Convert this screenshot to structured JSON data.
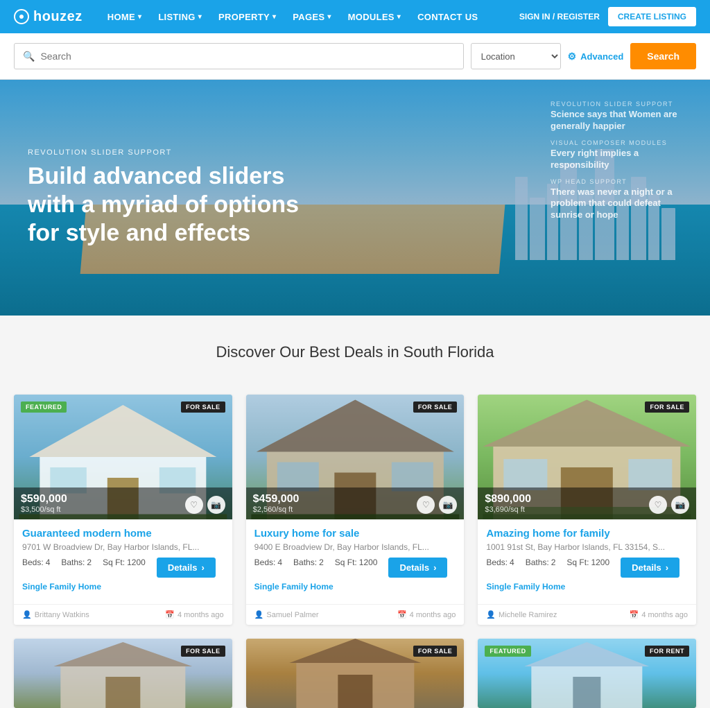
{
  "brand": {
    "name": "houzez"
  },
  "navbar": {
    "links": [
      {
        "label": "HOME",
        "has_dropdown": true
      },
      {
        "label": "LISTING",
        "has_dropdown": true
      },
      {
        "label": "PROPERTY",
        "has_dropdown": true
      },
      {
        "label": "PAGES",
        "has_dropdown": true
      },
      {
        "label": "MODULES",
        "has_dropdown": true
      },
      {
        "label": "CONTACT US",
        "has_dropdown": false
      }
    ],
    "signin_label": "SIGN IN / REGISTER",
    "create_label": "CREATE LISTING"
  },
  "search_bar": {
    "placeholder": "Search",
    "location_label": "Location",
    "advanced_label": "Advanced",
    "search_button": "Search"
  },
  "hero": {
    "subtitle": "REVOLUTION SLIDER SUPPORT",
    "title": "Build advanced sliders with a myriad of options for style and effects",
    "side_cards": [
      {
        "subtitle": "REVOLUTION SLIDER SUPPORT",
        "title": "Science says that Women are generally happier"
      },
      {
        "subtitle": "VISUAL COMPOSER MODULES",
        "title": "Every right implies a responsibility"
      },
      {
        "subtitle": "WP HEAD SUPPORT",
        "title": "There was never a night or a problem that could defeat sunrise or hope"
      }
    ]
  },
  "section": {
    "title": "Discover Our Best Deals in South Florida"
  },
  "properties": [
    {
      "id": 1,
      "featured": true,
      "badge": "FOR SALE",
      "price": "$590,000",
      "price_per": "$3,500/sq ft",
      "title": "Guaranteed modern home",
      "address": "9701 W Broadview Dr, Bay Harbor Islands, FL...",
      "beds": "4",
      "baths": "2",
      "sqft": "1200",
      "type": "Single Family Home",
      "agent": "Brittany Watkins",
      "time": "4 months ago",
      "bg_class": "house-bg-1"
    },
    {
      "id": 2,
      "featured": false,
      "badge": "FOR SALE",
      "price": "$459,000",
      "price_per": "$2,560/sq ft",
      "title": "Luxury home for sale",
      "address": "9400 E Broadview Dr, Bay Harbor Islands, FL...",
      "beds": "4",
      "baths": "2",
      "sqft": "1200",
      "type": "Single Family Home",
      "agent": "Samuel Palmer",
      "time": "4 months ago",
      "bg_class": "house-bg-2"
    },
    {
      "id": 3,
      "featured": false,
      "badge": "FOR SALE",
      "price": "$890,000",
      "price_per": "$3,690/sq ft",
      "title": "Amazing home for family",
      "address": "1001 91st St, Bay Harbor Islands, FL 33154, S...",
      "beds": "4",
      "baths": "2",
      "sqft": "1200",
      "type": "Single Family Home",
      "agent": "Michelle Ramirez",
      "time": "4 months ago",
      "bg_class": "house-bg-3"
    }
  ],
  "properties_bottom": [
    {
      "id": 4,
      "featured": false,
      "badge": "FOR SALE",
      "bg_class": "house-bg-4"
    },
    {
      "id": 5,
      "featured": false,
      "badge": "FOR SALE",
      "bg_class": "house-bg-5"
    },
    {
      "id": 6,
      "featured": true,
      "badge": "FOR RENT",
      "bg_class": "house-bg-6"
    }
  ],
  "labels": {
    "beds": "Beds:",
    "baths": "Baths:",
    "sqft": "Sq Ft:",
    "details": "Details",
    "featured": "FEATURED",
    "for_sale": "FOR SALE",
    "for_rent": "FOR RENT"
  },
  "icons": {
    "search": "🔍",
    "gear": "⚙",
    "chevron": "▾",
    "heart": "♡",
    "camera": "📷",
    "person": "👤",
    "calendar": "📅",
    "arrow_right": "›"
  }
}
